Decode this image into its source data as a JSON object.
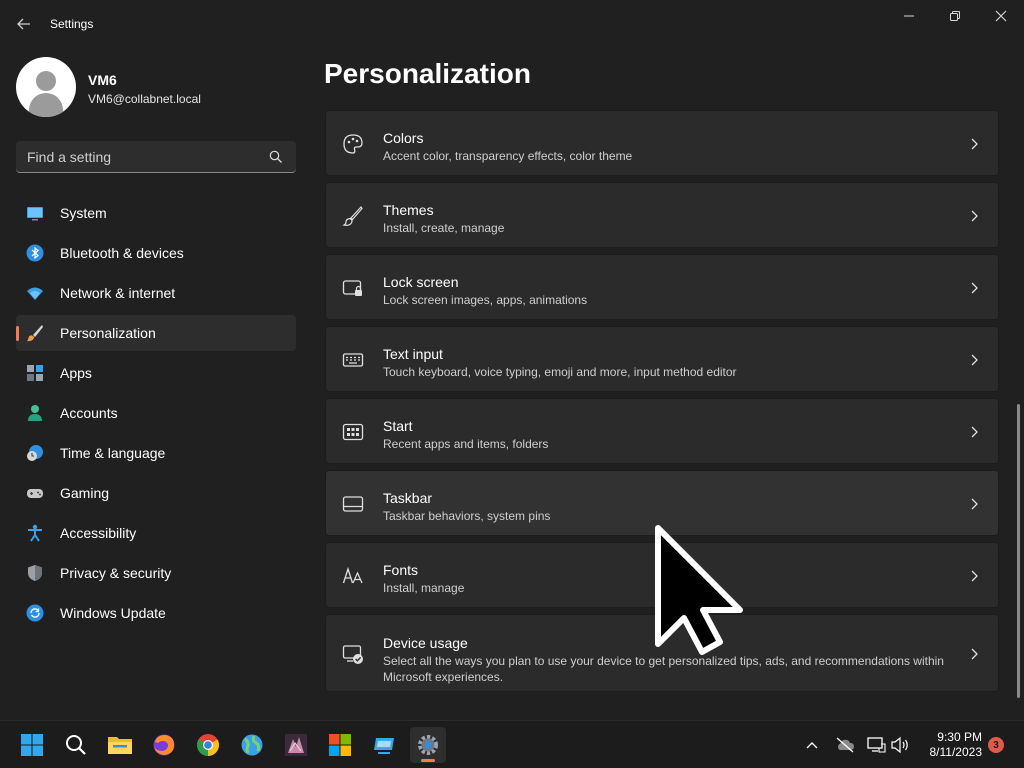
{
  "window": {
    "title": "Settings",
    "controls": {
      "minimize": "—",
      "maximize": "❐",
      "close": "✕"
    }
  },
  "profile": {
    "name": "VM6",
    "email": "VM6@collabnet.local"
  },
  "search": {
    "placeholder": "Find a setting"
  },
  "nav": {
    "items": [
      {
        "label": "System",
        "icon": "monitor-icon",
        "selected": false
      },
      {
        "label": "Bluetooth & devices",
        "icon": "bluetooth-icon",
        "selected": false
      },
      {
        "label": "Network & internet",
        "icon": "wifi-icon",
        "selected": false
      },
      {
        "label": "Personalization",
        "icon": "brush-icon",
        "selected": true
      },
      {
        "label": "Apps",
        "icon": "apps-icon",
        "selected": false
      },
      {
        "label": "Accounts",
        "icon": "person-icon",
        "selected": false
      },
      {
        "label": "Time & language",
        "icon": "globe-clock-icon",
        "selected": false
      },
      {
        "label": "Gaming",
        "icon": "gamepad-icon",
        "selected": false
      },
      {
        "label": "Accessibility",
        "icon": "accessibility-icon",
        "selected": false
      },
      {
        "label": "Privacy & security",
        "icon": "shield-icon",
        "selected": false
      },
      {
        "label": "Windows Update",
        "icon": "update-icon",
        "selected": false
      }
    ]
  },
  "main": {
    "title": "Personalization",
    "cards": [
      {
        "title": "Colors",
        "description": "Accent color, transparency effects, color theme",
        "icon": "palette-icon"
      },
      {
        "title": "Themes",
        "description": "Install, create, manage",
        "icon": "brush-icon"
      },
      {
        "title": "Lock screen",
        "description": "Lock screen images, apps, animations",
        "icon": "lock-screen-icon"
      },
      {
        "title": "Text input",
        "description": "Touch keyboard, voice typing, emoji and more, input method editor",
        "icon": "keyboard-icon"
      },
      {
        "title": "Start",
        "description": "Recent apps and items, folders",
        "icon": "start-icon"
      },
      {
        "title": "Taskbar",
        "description": "Taskbar behaviors, system pins",
        "icon": "taskbar-icon"
      },
      {
        "title": "Fonts",
        "description": "Install, manage",
        "icon": "fonts-icon"
      },
      {
        "title": "Device usage",
        "description": "Select all the ways you plan to use your device to get personalized tips, ads, and recommendations within Microsoft experiences.",
        "icon": "device-usage-icon"
      }
    ]
  },
  "taskbar": {
    "apps": [
      {
        "name": "start",
        "icon": "windows-logo-icon"
      },
      {
        "name": "search",
        "icon": "search-icon"
      },
      {
        "name": "file-explorer",
        "icon": "folder-icon"
      },
      {
        "name": "firefox",
        "icon": "firefox-icon"
      },
      {
        "name": "chrome",
        "icon": "chrome-icon"
      },
      {
        "name": "app-globe",
        "icon": "globe-app-icon"
      },
      {
        "name": "app-image",
        "icon": "image-app-icon"
      },
      {
        "name": "microsoft-store",
        "icon": "store-icon"
      },
      {
        "name": "app-remote",
        "icon": "remote-app-icon"
      },
      {
        "name": "settings",
        "icon": "settings-icon",
        "active": true
      }
    ],
    "clock": {
      "time": "9:30 PM",
      "date": "8/11/2023"
    },
    "notification_count": "3",
    "colors": {
      "accent": "#f47a5a",
      "badge": "#e05a4a"
    }
  }
}
